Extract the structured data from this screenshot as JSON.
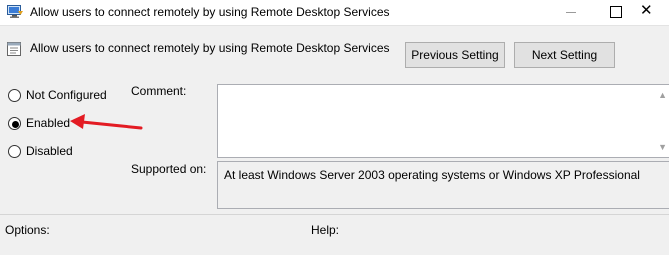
{
  "window": {
    "title": "Allow users to connect remotely by using Remote Desktop Services",
    "close_glyph": "✕"
  },
  "policy": {
    "name": "Allow users to connect remotely by using Remote Desktop Services"
  },
  "buttons": {
    "previous": "Previous Setting",
    "next": "Next Setting"
  },
  "state": {
    "options": [
      {
        "label": "Not Configured",
        "selected": false
      },
      {
        "label": "Enabled",
        "selected": true
      },
      {
        "label": "Disabled",
        "selected": false
      }
    ]
  },
  "comment": {
    "label": "Comment:",
    "value": ""
  },
  "supported": {
    "label": "Supported on:",
    "value": "At least Windows Server 2003 operating systems or Windows XP Professional"
  },
  "panels": {
    "options_label": "Options:",
    "help_label": "Help:"
  },
  "annotation": {
    "arrow_color": "#e31b23"
  },
  "icons": {
    "title": "remote-desktop-policy-icon",
    "policy": "policy-setting-icon",
    "scroll_up": "scroll-up-arrow-icon",
    "scroll_down": "scroll-down-arrow-icon"
  }
}
